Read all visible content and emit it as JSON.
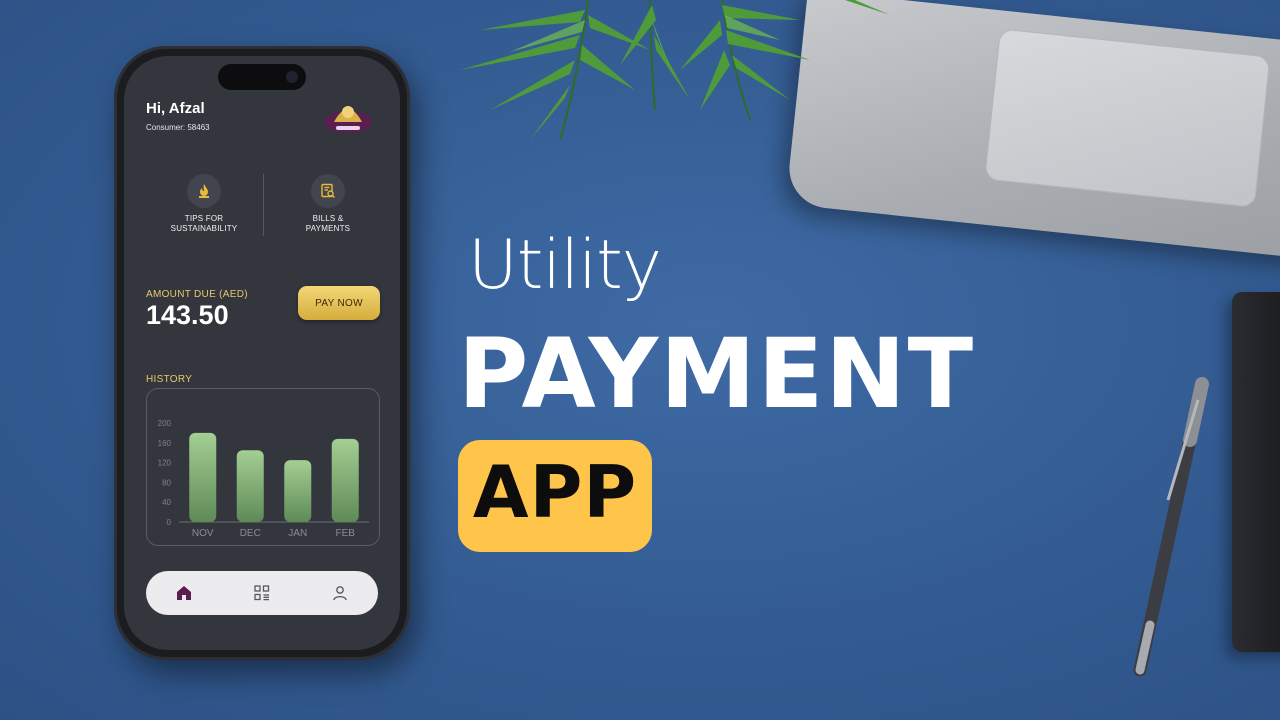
{
  "headline": {
    "line1": "Utility",
    "line2": "PAYMENT",
    "badge": "APP"
  },
  "app": {
    "greeting": "Hi, Afzal",
    "consumer": "Consumer: 58463",
    "quick_actions": [
      {
        "label_line1": "TIPS FOR",
        "label_line2": "SUSTAINABILITY",
        "icon": "flame-icon"
      },
      {
        "label_line1": "BILLS &",
        "label_line2": "PAYMENTS",
        "icon": "bill-search-icon"
      }
    ],
    "amount_due_label": "AMOUNT DUE (AED)",
    "amount_due": "143.50",
    "pay_button": "PAY NOW",
    "history_label": "HISTORY",
    "tabs": [
      {
        "name": "home",
        "icon": "home-icon"
      },
      {
        "name": "grid",
        "icon": "grid-list-icon"
      },
      {
        "name": "profile",
        "icon": "user-icon"
      }
    ]
  },
  "colors": {
    "background": "#355e95",
    "accent_gold": "#e8c86a",
    "badge_yellow": "#ffc54a",
    "bar_green": "#9bc48d",
    "home_icon": "#5a1f4f"
  },
  "chart_data": {
    "type": "bar",
    "categories": [
      "NOV",
      "DEC",
      "JAN",
      "FEB"
    ],
    "values": [
      180,
      145,
      125,
      168
    ],
    "yticks": [
      0,
      40,
      80,
      120,
      160,
      200
    ],
    "ylim": [
      0,
      200
    ],
    "title": "HISTORY",
    "xlabel": "",
    "ylabel": "",
    "grid": false
  }
}
